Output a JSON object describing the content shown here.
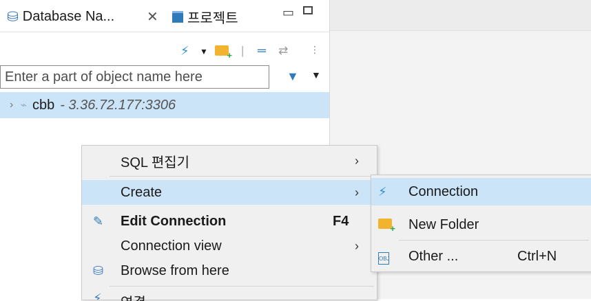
{
  "tabs": {
    "db_navigator": "Database Na...",
    "project": "프로젝트"
  },
  "filter": {
    "placeholder": "Enter a part of object name here"
  },
  "tree": {
    "connection_name": "cbb",
    "connection_address": "- 3.36.72.177:3306"
  },
  "context_menu": {
    "sql_editor": "SQL 편집기",
    "create": "Create",
    "edit_connection": "Edit Connection",
    "edit_connection_accel": "F4",
    "connection_view": "Connection view",
    "browse_from_here": "Browse from here",
    "partial_next": "연결"
  },
  "submenu": {
    "connection": "Connection",
    "new_folder": "New Folder",
    "other": "Other ...",
    "other_accel": "Ctrl+N"
  },
  "icons": {
    "db_tab": "database-icon",
    "project_tab": "project-icon",
    "new_connection": "plug-add-icon",
    "new_folder": "folder-add-icon",
    "filter": "filter-icon",
    "edit": "pencil-icon",
    "browse": "database-browse-icon",
    "other": "object-icon"
  },
  "colors": {
    "highlight": "#cce4f7",
    "menu_bg": "#f0f0f0",
    "accent": "#2f7ab9"
  }
}
